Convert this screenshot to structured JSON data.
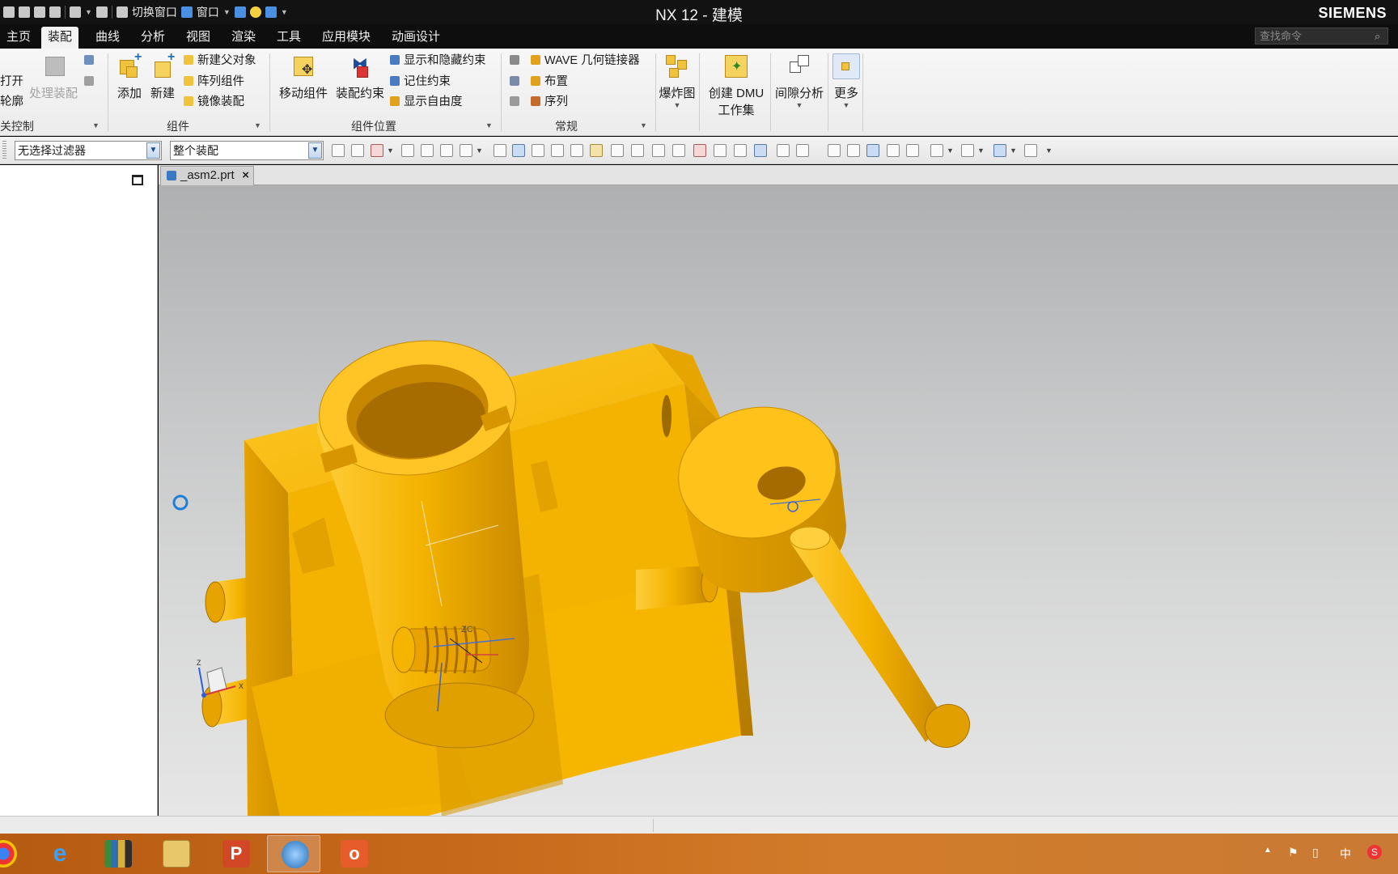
{
  "titlebar": {
    "app_title": "NX 12 - 建模",
    "brand": "SIEMENS",
    "quick_access": {
      "switch_window": "切换窗口",
      "window": "窗口"
    }
  },
  "menu": {
    "tabs": [
      {
        "label": "主页",
        "active": false
      },
      {
        "label": "装配",
        "active": true
      },
      {
        "label": "曲线",
        "active": false
      },
      {
        "label": "分析",
        "active": false
      },
      {
        "label": "视图",
        "active": false
      },
      {
        "label": "渲染",
        "active": false
      },
      {
        "label": "工具",
        "active": false
      },
      {
        "label": "应用模块",
        "active": false
      },
      {
        "label": "动画设计",
        "active": false
      }
    ],
    "search_placeholder": "查找命令"
  },
  "ribbon": {
    "group1": {
      "label": "关控制",
      "open": "打开",
      "outline": "轮廓",
      "process_assembly": "处理装配"
    },
    "components": {
      "label": "组件",
      "add": "添加",
      "new": "新建",
      "new_parent": "新建父对象",
      "pattern": "阵列组件",
      "mirror": "镜像装配"
    },
    "position": {
      "label": "组件位置",
      "move": "移动组件",
      "constraint": "装配约束",
      "show_hide": "显示和隐藏约束",
      "remember": "记住约束",
      "dof": "显示自由度"
    },
    "general": {
      "label": "常规",
      "wave": "WAVE 几何链接器",
      "arrangement": "布置",
      "sequence": "序列"
    },
    "exploded": "爆炸图",
    "dmu": {
      "line1": "创建 DMU",
      "line2": "工作集"
    },
    "clearance": "间隙分析",
    "more": "更多"
  },
  "selection_bar": {
    "type_filter": "无选择过滤器",
    "scope": "整个装配"
  },
  "document": {
    "tab": "_asm2.prt"
  },
  "viewport": {
    "wcs_label": "ZC",
    "triad": {
      "x": "X",
      "z": "Z"
    },
    "model_color": "#f5b000"
  },
  "colors": {
    "accent": "#1e6fb8",
    "taskbar": "#c86a1b"
  },
  "taskbar": {
    "apps": [
      "chrome",
      "internet-explorer",
      "library",
      "file-explorer",
      "powerpoint",
      "nx",
      "office"
    ],
    "tray_ime": "中"
  }
}
